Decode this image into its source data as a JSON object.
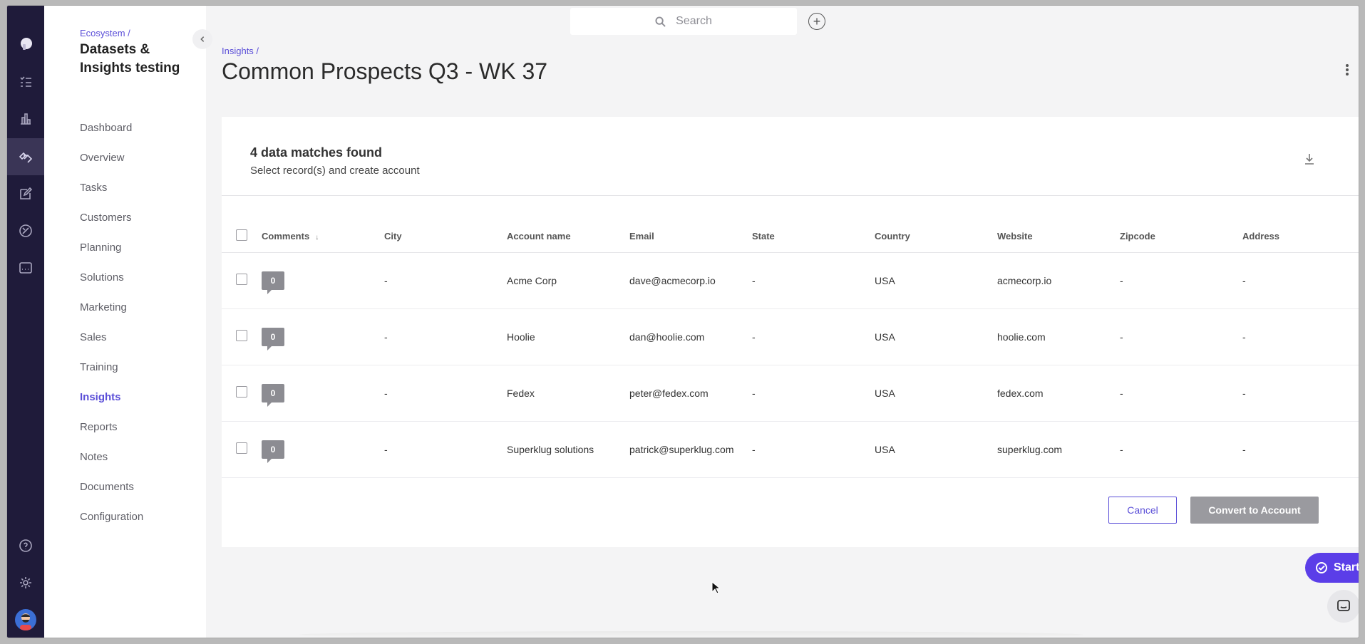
{
  "sidebar": {
    "breadcrumb": "Ecosystem /",
    "workspace_title": "Datasets & Insights testing",
    "items": [
      {
        "label": "Dashboard"
      },
      {
        "label": "Overview"
      },
      {
        "label": "Tasks"
      },
      {
        "label": "Customers"
      },
      {
        "label": "Planning"
      },
      {
        "label": "Solutions"
      },
      {
        "label": "Marketing"
      },
      {
        "label": "Sales"
      },
      {
        "label": "Training"
      },
      {
        "label": "Insights",
        "active": true
      },
      {
        "label": "Reports"
      },
      {
        "label": "Notes"
      },
      {
        "label": "Documents"
      },
      {
        "label": "Configuration"
      }
    ]
  },
  "topbar": {
    "search_placeholder": "Search"
  },
  "page": {
    "breadcrumb": "Insights /",
    "title": "Common Prospects Q3 - WK 37"
  },
  "card": {
    "heading": "4 data matches found",
    "subheading": "Select record(s) and create account"
  },
  "table": {
    "columns": [
      "Comments",
      "City",
      "Account name",
      "Email",
      "State",
      "Country",
      "Website",
      "Zipcode",
      "Address"
    ],
    "rows": [
      {
        "comments": "0",
        "city": "-",
        "account": "Acme Corp",
        "email": "dave@acmecorp.io",
        "state": "-",
        "country": "USA",
        "website": "acmecorp.io",
        "zip": "-",
        "address": "-"
      },
      {
        "comments": "0",
        "city": "-",
        "account": "Hoolie",
        "email": "dan@hoolie.com",
        "state": "-",
        "country": "USA",
        "website": "hoolie.com",
        "zip": "-",
        "address": "-"
      },
      {
        "comments": "0",
        "city": "-",
        "account": "Fedex",
        "email": "peter@fedex.com",
        "state": "-",
        "country": "USA",
        "website": "fedex.com",
        "zip": "-",
        "address": "-"
      },
      {
        "comments": "0",
        "city": "-",
        "account": "Superklug solutions",
        "email": "patrick@superklug.com",
        "state": "-",
        "country": "USA",
        "website": "superklug.com",
        "zip": "-",
        "address": "-"
      }
    ]
  },
  "actions": {
    "cancel": "Cancel",
    "convert": "Convert to Account",
    "start": "Start"
  },
  "colors": {
    "accent": "#5b4fd8",
    "rail": "#1f1b3a",
    "disabled_button": "#9a9a9f"
  },
  "icons": [
    "logo-icon",
    "tasks-icon",
    "chart-icon",
    "insights-icon",
    "edit-icon",
    "solutions-icon",
    "reports-icon",
    "help-icon",
    "gear-icon",
    "avatar",
    "search-icon",
    "plus-icon",
    "kebab-icon",
    "download-icon",
    "check-icon",
    "chat-icon"
  ]
}
